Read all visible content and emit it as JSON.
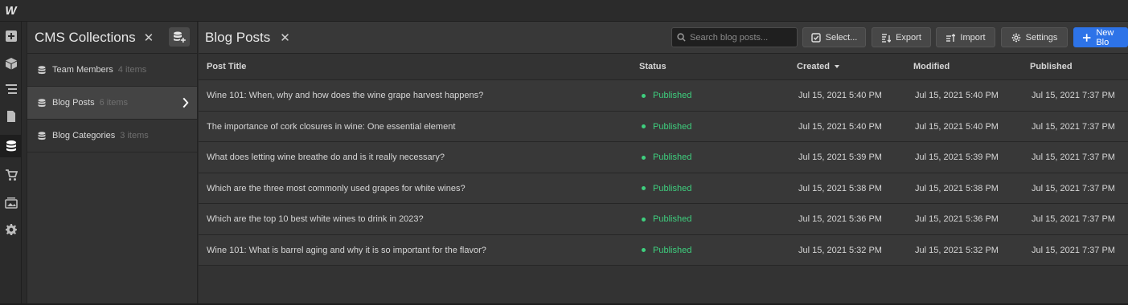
{
  "app": {
    "logo": "W"
  },
  "rail": [
    {
      "icon": "add-icon"
    },
    {
      "icon": "cube-icon"
    },
    {
      "icon": "navigator-icon"
    },
    {
      "icon": "pages-icon"
    },
    {
      "icon": "cms-database-icon",
      "active": true
    },
    {
      "icon": "ecommerce-cart-icon"
    },
    {
      "icon": "assets-icon"
    },
    {
      "icon": "settings-gear-icon"
    }
  ],
  "cms": {
    "title": "CMS Collections",
    "close": "✕",
    "collections": [
      {
        "name": "Team Members",
        "count": "4 items",
        "active": false
      },
      {
        "name": "Blog Posts",
        "count": "6 items",
        "active": true
      },
      {
        "name": "Blog Categories",
        "count": "3 items",
        "active": false
      }
    ]
  },
  "main": {
    "title": "Blog Posts",
    "close": "✕",
    "search_placeholder": "Search blog posts...",
    "toolbar": {
      "select": "Select...",
      "export": "Export",
      "import": "Import",
      "settings": "Settings",
      "new": "New Blo"
    },
    "columns": {
      "title": "Post Title",
      "status": "Status",
      "created": "Created",
      "modified": "Modified",
      "published": "Published"
    },
    "rows": [
      {
        "title": "Wine 101: When, why and how does the wine grape harvest happens?",
        "status": "Published",
        "created": "Jul 15, 2021 5:40 PM",
        "modified": "Jul 15, 2021 5:40 PM",
        "published": "Jul 15, 2021 7:37 PM"
      },
      {
        "title": "The importance of cork closures in wine: One essential element",
        "status": "Published",
        "created": "Jul 15, 2021 5:40 PM",
        "modified": "Jul 15, 2021 5:40 PM",
        "published": "Jul 15, 2021 7:37 PM"
      },
      {
        "title": "What does letting wine breathe do and is it really necessary?",
        "status": "Published",
        "created": "Jul 15, 2021 5:39 PM",
        "modified": "Jul 15, 2021 5:39 PM",
        "published": "Jul 15, 2021 7:37 PM"
      },
      {
        "title": "Which are the three most commonly used grapes for white wines?",
        "status": "Published",
        "created": "Jul 15, 2021 5:38 PM",
        "modified": "Jul 15, 2021 5:38 PM",
        "published": "Jul 15, 2021 7:37 PM"
      },
      {
        "title": "Which are the top 10 best white wines to drink in 2023?",
        "status": "Published",
        "created": "Jul 15, 2021 5:36 PM",
        "modified": "Jul 15, 2021 5:36 PM",
        "published": "Jul 15, 2021 7:37 PM"
      },
      {
        "title": "Wine 101: What is barrel aging and why it is so important for the flavor?",
        "status": "Published",
        "created": "Jul 15, 2021 5:32 PM",
        "modified": "Jul 15, 2021 5:32 PM",
        "published": "Jul 15, 2021 7:37 PM"
      }
    ]
  },
  "colors": {
    "accent": "#2d73e8",
    "status_published": "#3ecf7e",
    "background": "#333333"
  }
}
